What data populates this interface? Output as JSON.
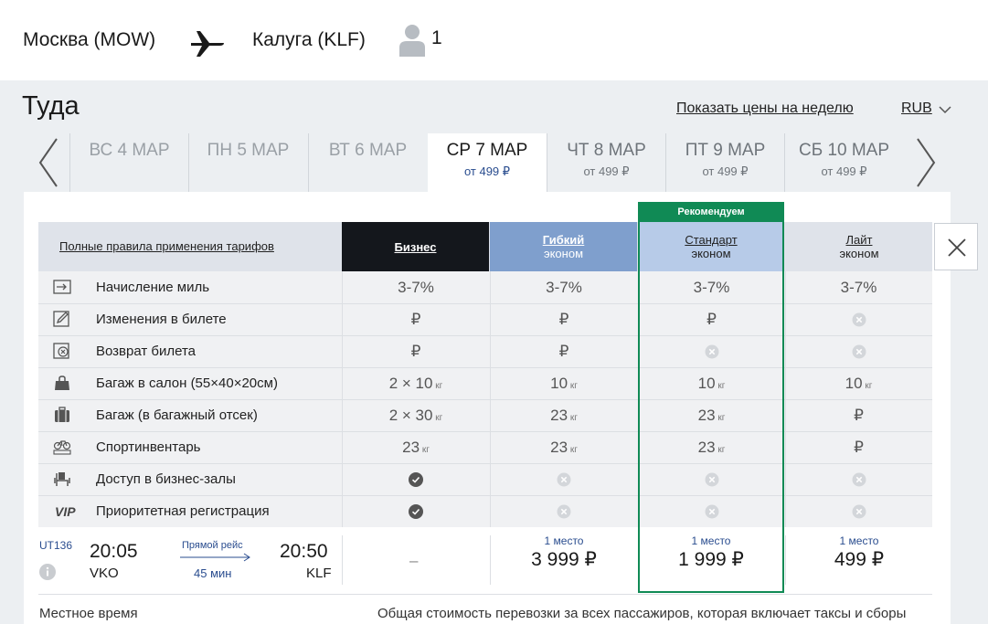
{
  "header": {
    "from": "Москва (MOW)",
    "to": "Калуга (KLF)",
    "passengers": "1"
  },
  "direction_title": "Туда",
  "week_prices_link": "Показать цены на неделю",
  "currency": "RUB",
  "dates": [
    {
      "label": "ВС 4 МАР",
      "price": ""
    },
    {
      "label": "ПН 5 МАР",
      "price": ""
    },
    {
      "label": "ВТ 6 МАР",
      "price": ""
    },
    {
      "label": "СР 7 МАР",
      "price": "от 499 ₽"
    },
    {
      "label": "ЧТ 8 МАР",
      "price": "от 499 ₽"
    },
    {
      "label": "ПТ 9 МАР",
      "price": "от 499 ₽"
    },
    {
      "label": "СБ 10 МАР",
      "price": "от 499 ₽"
    }
  ],
  "selected_date_index": 3,
  "rules_link": "Полные правила применения тарифов",
  "recommend_badge": "Рекомендуем",
  "fares": [
    {
      "name": "Бизнес",
      "sub": ""
    },
    {
      "name": "Гибкий",
      "sub": "эконом"
    },
    {
      "name": "Стандарт",
      "sub": "эконом"
    },
    {
      "name": "Лайт",
      "sub": "эконом"
    }
  ],
  "features": [
    {
      "label": "Начисление миль",
      "icon": "miles-icon"
    },
    {
      "label": "Изменения в билете",
      "icon": "edit-ticket-icon"
    },
    {
      "label": "Возврат билета",
      "icon": "refund-ticket-icon"
    },
    {
      "label": "Багаж в салон (55×40×20см)",
      "icon": "cabin-bag-icon"
    },
    {
      "label": "Багаж (в багажный отсек)",
      "icon": "suitcase-icon"
    },
    {
      "label": "Спортинвентарь",
      "icon": "bicycle-icon"
    },
    {
      "label": "Доступ в бизнес-залы",
      "icon": "lounge-chair-icon"
    },
    {
      "label": "Приоритетная регистрация",
      "icon": "vip-icon"
    }
  ],
  "matrix": {
    "miles": [
      "3-7%",
      "3-7%",
      "3-7%",
      "3-7%"
    ],
    "change": [
      "₽",
      "₽",
      "₽",
      "no"
    ],
    "refund": [
      "₽",
      "₽",
      "no",
      "no"
    ],
    "cabin": [
      {
        "v": "2 × 10",
        "u": "кг"
      },
      {
        "v": "10",
        "u": "кг"
      },
      {
        "v": "10",
        "u": "кг"
      },
      {
        "v": "10",
        "u": "кг"
      }
    ],
    "hold": [
      {
        "v": "2 × 30",
        "u": "кг"
      },
      {
        "v": "23",
        "u": "кг"
      },
      {
        "v": "23",
        "u": "кг"
      },
      {
        "v": "₽",
        "u": ""
      }
    ],
    "sport": [
      {
        "v": "23",
        "u": "кг"
      },
      {
        "v": "23",
        "u": "кг"
      },
      {
        "v": "23",
        "u": "кг"
      },
      {
        "v": "₽",
        "u": ""
      }
    ],
    "lounge": [
      "yes",
      "no",
      "no",
      "no"
    ],
    "priority": [
      "yes",
      "no",
      "no",
      "no"
    ]
  },
  "flight": {
    "number": "UT136",
    "dep_time": "20:05",
    "dep_code": "VKO",
    "type": "Прямой рейс",
    "duration": "45 мин",
    "arr_time": "20:50",
    "arr_code": "KLF"
  },
  "prices": {
    "business": "–",
    "flex": {
      "seats": "1 место",
      "amount": "3 999 ₽"
    },
    "standard": {
      "seats": "1 место",
      "amount": "1 999 ₽"
    },
    "lite": {
      "seats": "1 место",
      "amount": "499 ₽"
    }
  },
  "footer": {
    "local_time": "Местное время",
    "total_note": "Общая стоимость перевозки за всех пассажиров, которая включает таксы и сборы"
  },
  "colors": {
    "accent_green": "#108a55",
    "business_dark": "#14171c",
    "flex_blue": "#7f9fcd",
    "standard_blue": "#b7cbe8",
    "link_blue": "#2a4d8f"
  }
}
